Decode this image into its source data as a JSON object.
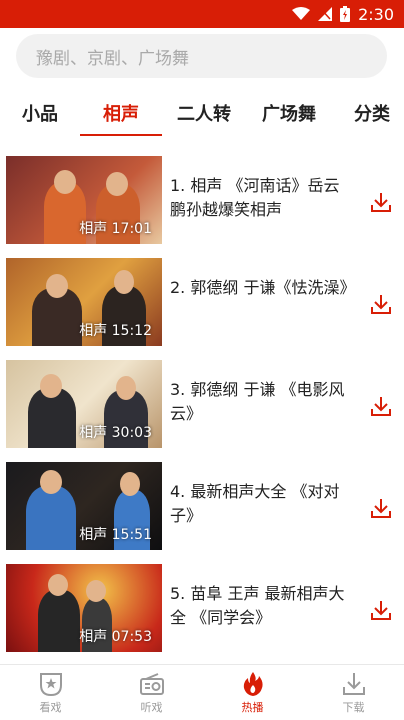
{
  "status": {
    "time": "2:30"
  },
  "search": {
    "placeholder": "豫剧、京剧、广场舞"
  },
  "tabs": [
    {
      "label": "小品"
    },
    {
      "label": "相声"
    },
    {
      "label": "二人转"
    },
    {
      "label": "广场舞"
    },
    {
      "label": "分类"
    }
  ],
  "active_tab": "相声",
  "videos": [
    {
      "title": "1. 相声 《河南话》岳云鹏孙越爆笑相声",
      "duration": "相声 17:01"
    },
    {
      "title": "2. 郭德纲 于谦《怯洗澡》",
      "duration": "相声 15:12"
    },
    {
      "title": "3. 郭德纲 于谦 《电影风云》",
      "duration": "相声 30:03"
    },
    {
      "title": "4. 最新相声大全 《对对子》",
      "duration": "相声 15:51"
    },
    {
      "title": "5. 苗阜 王声 最新相声大全 《同学会》",
      "duration": "相声 07:53"
    }
  ],
  "bottom_nav": [
    {
      "label": "看戏"
    },
    {
      "label": "听戏"
    },
    {
      "label": "热播"
    },
    {
      "label": "下载"
    }
  ],
  "colors": {
    "accent": "#d81e06",
    "text": "#222222",
    "muted": "#9a9a9a"
  }
}
